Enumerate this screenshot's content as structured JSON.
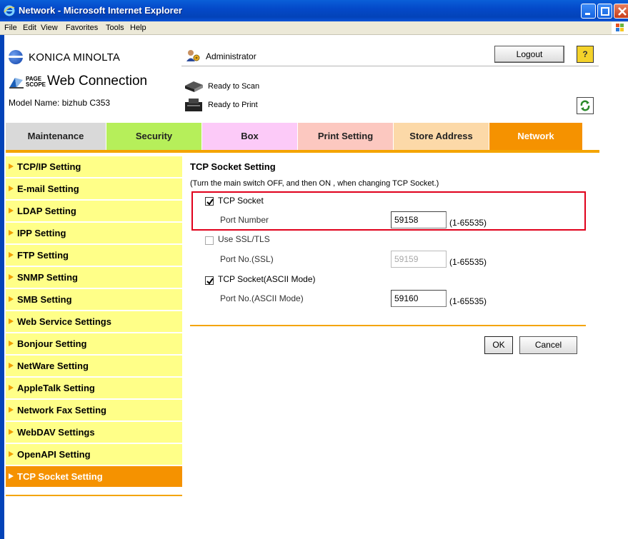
{
  "window": {
    "title": "Network - Microsoft Internet Explorer",
    "controls": [
      "minimize-icon",
      "maximize-icon",
      "close-icon"
    ]
  },
  "menubar": {
    "items": [
      "File",
      "Edit",
      "View",
      "Favorites",
      "Tools",
      "Help"
    ]
  },
  "header": {
    "brand": "KONICA MINOLTA",
    "product_mark_line1": "PAGE",
    "product_mark_line2": "SCOPE",
    "product": "Web Connection",
    "model_name": "Model Name: bizhub C353",
    "user": "Administrator",
    "logout_label": "Logout",
    "help_label": "?",
    "scan_status": "Ready to Scan",
    "print_status": "Ready to Print"
  },
  "tabs": [
    {
      "label": "Maintenance",
      "color": "#d9d9d9"
    },
    {
      "label": "Security",
      "color": "#b6ef5a"
    },
    {
      "label": "Box",
      "color": "#fccaf8"
    },
    {
      "label": "Print Setting",
      "color": "#fcc8c0"
    },
    {
      "label": "Store Address",
      "color": "#fcd9a8"
    },
    {
      "label": "Network",
      "color": "#f59200",
      "active": true
    }
  ],
  "sidebar": {
    "items": [
      {
        "label": "TCP/IP Setting"
      },
      {
        "label": "E-mail Setting"
      },
      {
        "label": "LDAP Setting"
      },
      {
        "label": "IPP Setting"
      },
      {
        "label": "FTP Setting"
      },
      {
        "label": "SNMP Setting"
      },
      {
        "label": "SMB Setting"
      },
      {
        "label": "Web Service Settings"
      },
      {
        "label": "Bonjour Setting"
      },
      {
        "label": "NetWare Setting"
      },
      {
        "label": "AppleTalk Setting"
      },
      {
        "label": "Network Fax Setting"
      },
      {
        "label": "WebDAV Settings"
      },
      {
        "label": "OpenAPI Setting"
      },
      {
        "label": "TCP Socket Setting",
        "active": true
      }
    ]
  },
  "main": {
    "title": "TCP Socket Setting",
    "note": "(Turn the main switch OFF, and then ON , when changing TCP Socket.)",
    "tcp_socket": {
      "label": "TCP Socket",
      "checked": true
    },
    "port_number": {
      "label": "Port Number",
      "value": "59158",
      "range": "(1-65535)"
    },
    "use_ssl": {
      "label": "Use SSL/TLS",
      "checked": false
    },
    "port_ssl": {
      "label": "Port No.(SSL)",
      "value": "59159",
      "range": "(1-65535)",
      "disabled": true
    },
    "tcp_ascii": {
      "label": "TCP Socket(ASCII Mode)",
      "checked": true
    },
    "port_ascii": {
      "label": "Port No.(ASCII Mode)",
      "value": "59160",
      "range": "(1-65535)"
    },
    "ok_label": "OK",
    "cancel_label": "Cancel"
  },
  "colors": {
    "accent": "#f59200",
    "sidebar_bg": "#ffff88",
    "highlight": "#e0001b",
    "titlebar": "#0343b8"
  }
}
